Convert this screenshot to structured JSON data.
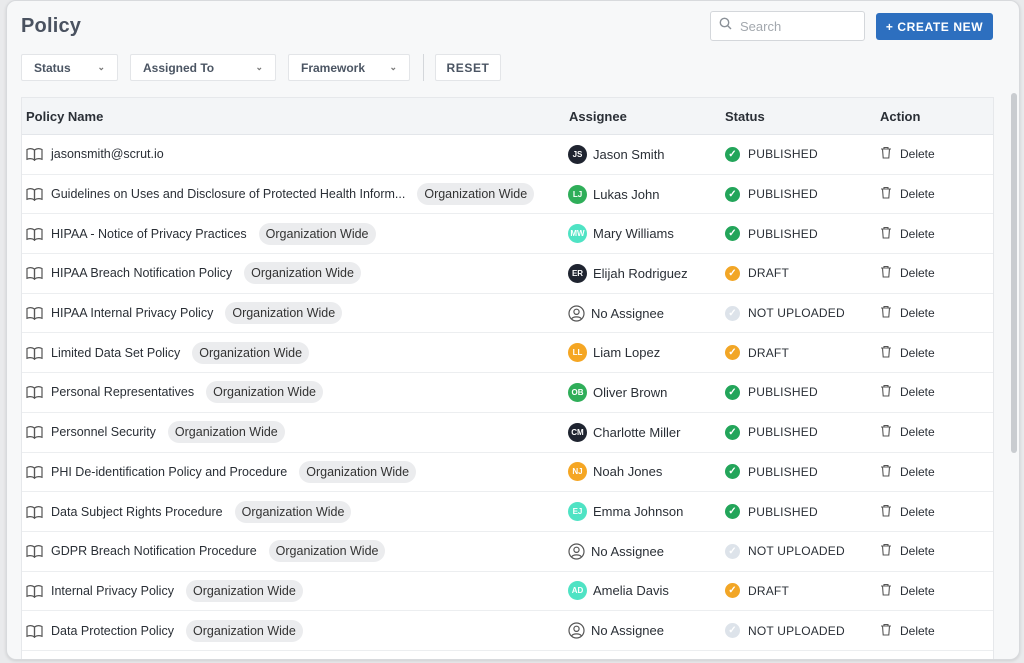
{
  "page": {
    "title": "Policy"
  },
  "search": {
    "placeholder": "Search"
  },
  "actions": {
    "create_label": "+ CREATE NEW",
    "reset_label": "RESET"
  },
  "filters": [
    {
      "label": "Status"
    },
    {
      "label": "Assigned To"
    },
    {
      "label": "Framework"
    }
  ],
  "table": {
    "headers": {
      "name": "Policy Name",
      "assignee": "Assignee",
      "status": "Status",
      "action": "Action"
    },
    "delete_label": "Delete",
    "rows": [
      {
        "name": "jasonsmith@scrut.io",
        "tag": "",
        "assignee": "Jason Smith",
        "initials": "JS",
        "avatar_color": "#1f2430",
        "status": "PUBLISHED",
        "status_kind": "published"
      },
      {
        "name": "Guidelines on Uses and Disclosure of Protected Health Inform...",
        "tag": "Organization Wide",
        "assignee": "Lukas John",
        "initials": "LJ",
        "avatar_color": "#2fae59",
        "status": "PUBLISHED",
        "status_kind": "published"
      },
      {
        "name": "HIPAA - Notice of Privacy Practices",
        "tag": "Organization Wide",
        "assignee": "Mary Williams",
        "initials": "MW",
        "avatar_color": "#4fe3c4",
        "status": "PUBLISHED",
        "status_kind": "published"
      },
      {
        "name": "HIPAA Breach Notification Policy",
        "tag": "Organization Wide",
        "assignee": "Elijah Rodriguez",
        "initials": "ER",
        "avatar_color": "#1f2430",
        "status": "DRAFT",
        "status_kind": "draft"
      },
      {
        "name": "HIPAA Internal Privacy Policy",
        "tag": "Organization Wide",
        "assignee": "No Assignee",
        "initials": "",
        "avatar_color": "",
        "status": "NOT UPLOADED",
        "status_kind": "notuploaded"
      },
      {
        "name": "Limited Data Set Policy",
        "tag": "Organization Wide",
        "assignee": "Liam Lopez",
        "initials": "LL",
        "avatar_color": "#f5a623",
        "status": "DRAFT",
        "status_kind": "draft"
      },
      {
        "name": "Personal Representatives",
        "tag": "Organization Wide",
        "assignee": "Oliver Brown",
        "initials": "OB",
        "avatar_color": "#2fae59",
        "status": "PUBLISHED",
        "status_kind": "published"
      },
      {
        "name": "Personnel Security",
        "tag": "Organization Wide",
        "assignee": "Charlotte Miller",
        "initials": "CM",
        "avatar_color": "#1f2430",
        "status": "PUBLISHED",
        "status_kind": "published"
      },
      {
        "name": "PHI De-identification Policy and Procedure",
        "tag": "Organization Wide",
        "assignee": "Noah Jones",
        "initials": "NJ",
        "avatar_color": "#f5a623",
        "status": "PUBLISHED",
        "status_kind": "published"
      },
      {
        "name": "Data Subject Rights Procedure",
        "tag": "Organization Wide",
        "assignee": "Emma Johnson",
        "initials": "EJ",
        "avatar_color": "#4fe3c4",
        "status": "PUBLISHED",
        "status_kind": "published"
      },
      {
        "name": "GDPR Breach Notification Procedure",
        "tag": "Organization Wide",
        "assignee": "No Assignee",
        "initials": "",
        "avatar_color": "",
        "status": "NOT UPLOADED",
        "status_kind": "notuploaded"
      },
      {
        "name": "Internal Privacy Policy",
        "tag": "Organization Wide",
        "assignee": "Amelia Davis",
        "initials": "AD",
        "avatar_color": "#4fe3c4",
        "status": "DRAFT",
        "status_kind": "draft"
      },
      {
        "name": "Data Protection Policy",
        "tag": "Organization Wide",
        "assignee": "No Assignee",
        "initials": "",
        "avatar_color": "",
        "status": "NOT UPLOADED",
        "status_kind": "notuploaded"
      }
    ]
  },
  "colors": {
    "primary": "#2d6fbf",
    "published": "#23a55a",
    "draft": "#f2a626",
    "notuploaded": "#dde3ea"
  }
}
